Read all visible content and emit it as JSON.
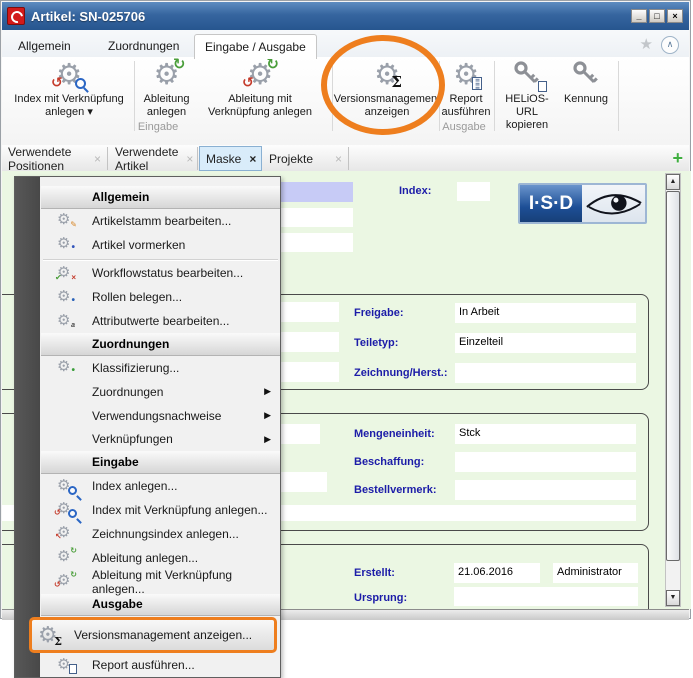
{
  "window": {
    "title": "Artikel: SN-025706",
    "controls": {
      "minimize": "_",
      "maximize": "□",
      "close": "×"
    }
  },
  "icons": {
    "gear": "⚙",
    "sigma": "Σ",
    "arrow-red": "↺",
    "arrow-green": "↻",
    "arrow-red-up": "↖",
    "check-green": "✔",
    "pencil": "✎",
    "dot-blue": "•",
    "letters": "a",
    "doc-lines": "≡ ≡ ≡",
    "caret-down": "▾",
    "submenu-arrow": "▶",
    "star": "★",
    "chevron-up": "∧",
    "close": "×",
    "plus": "+",
    "scroll-up": "▲",
    "scroll-down": "▼"
  },
  "ribbon": {
    "tabs": [
      {
        "label": "Allgemein"
      },
      {
        "label": "Zuordnungen"
      },
      {
        "label": "Eingabe / Ausgabe"
      }
    ],
    "buttons": [
      {
        "label": "Index mit Verknüpfung anlegen"
      },
      {
        "label": "Ableitung anlegen"
      },
      {
        "label": "Ableitung mit Verknüpfung anlegen"
      },
      {
        "label": "Versionsmanagement anzeigen"
      },
      {
        "label": "Report ausführen"
      },
      {
        "label": "HELiOS-URL kopieren"
      },
      {
        "label": "Kennung"
      }
    ],
    "group_labels": {
      "eingabe": "Eingabe",
      "ausgabe": "Ausgabe"
    }
  },
  "document_tabs": [
    {
      "label": "Verwendete Positionen"
    },
    {
      "label": "Verwendete Artikel"
    },
    {
      "label": "Maske"
    },
    {
      "label": "Projekte"
    }
  ],
  "form": {
    "index_label": "Index:",
    "index_value": "",
    "logo_text": "I·S·D",
    "groups": [
      {
        "fields": [
          {
            "label": "Freigabe:",
            "value": "In Arbeit"
          },
          {
            "label": "Teiletyp:",
            "value": "Einzelteil"
          },
          {
            "label": "Zeichnung/Herst.:",
            "value": ""
          }
        ]
      },
      {
        "fields": [
          {
            "label": "Mengeneinheit:",
            "value": "Stck"
          },
          {
            "label": "Beschaffung:",
            "value": ""
          },
          {
            "label": "Bestellvermerk:",
            "value": ""
          }
        ]
      },
      {
        "fields": [
          {
            "label": "Erstellt:",
            "value": "21.06.2016",
            "value2": "Administrator"
          },
          {
            "label": "Ursprung:",
            "value": ""
          }
        ]
      }
    ]
  },
  "context_menu": {
    "items": [
      {
        "type": "header",
        "label": "Allgemein"
      },
      {
        "type": "item",
        "label": "Artikelstamm bearbeiten..."
      },
      {
        "type": "item",
        "label": "Artikel vormerken"
      },
      {
        "type": "separator",
        "label": ""
      },
      {
        "type": "item",
        "label": "Workflowstatus bearbeiten..."
      },
      {
        "type": "item",
        "label": "Rollen belegen..."
      },
      {
        "type": "item",
        "label": "Attributwerte bearbeiten..."
      },
      {
        "type": "header",
        "label": "Zuordnungen"
      },
      {
        "type": "item",
        "label": "Klassifizierung..."
      },
      {
        "type": "item",
        "label": "Zuordnungen",
        "submenu": true
      },
      {
        "type": "item",
        "label": "Verwendungsnachweise",
        "submenu": true
      },
      {
        "type": "item",
        "label": "Verknüpfungen",
        "submenu": true
      },
      {
        "type": "header",
        "label": "Eingabe"
      },
      {
        "type": "item",
        "label": "Index anlegen..."
      },
      {
        "type": "item",
        "label": "Index mit Verknüpfung anlegen..."
      },
      {
        "type": "item",
        "label": "Zeichnungsindex anlegen..."
      },
      {
        "type": "item",
        "label": "Ableitung anlegen..."
      },
      {
        "type": "item",
        "label": "Ableitung mit Verknüpfung anlegen..."
      },
      {
        "type": "header",
        "label": "Ausgabe"
      },
      {
        "type": "item",
        "label": "Versionsmanagement anzeigen...",
        "highlighted": true
      },
      {
        "type": "item",
        "label": "Report ausführen..."
      }
    ]
  }
}
